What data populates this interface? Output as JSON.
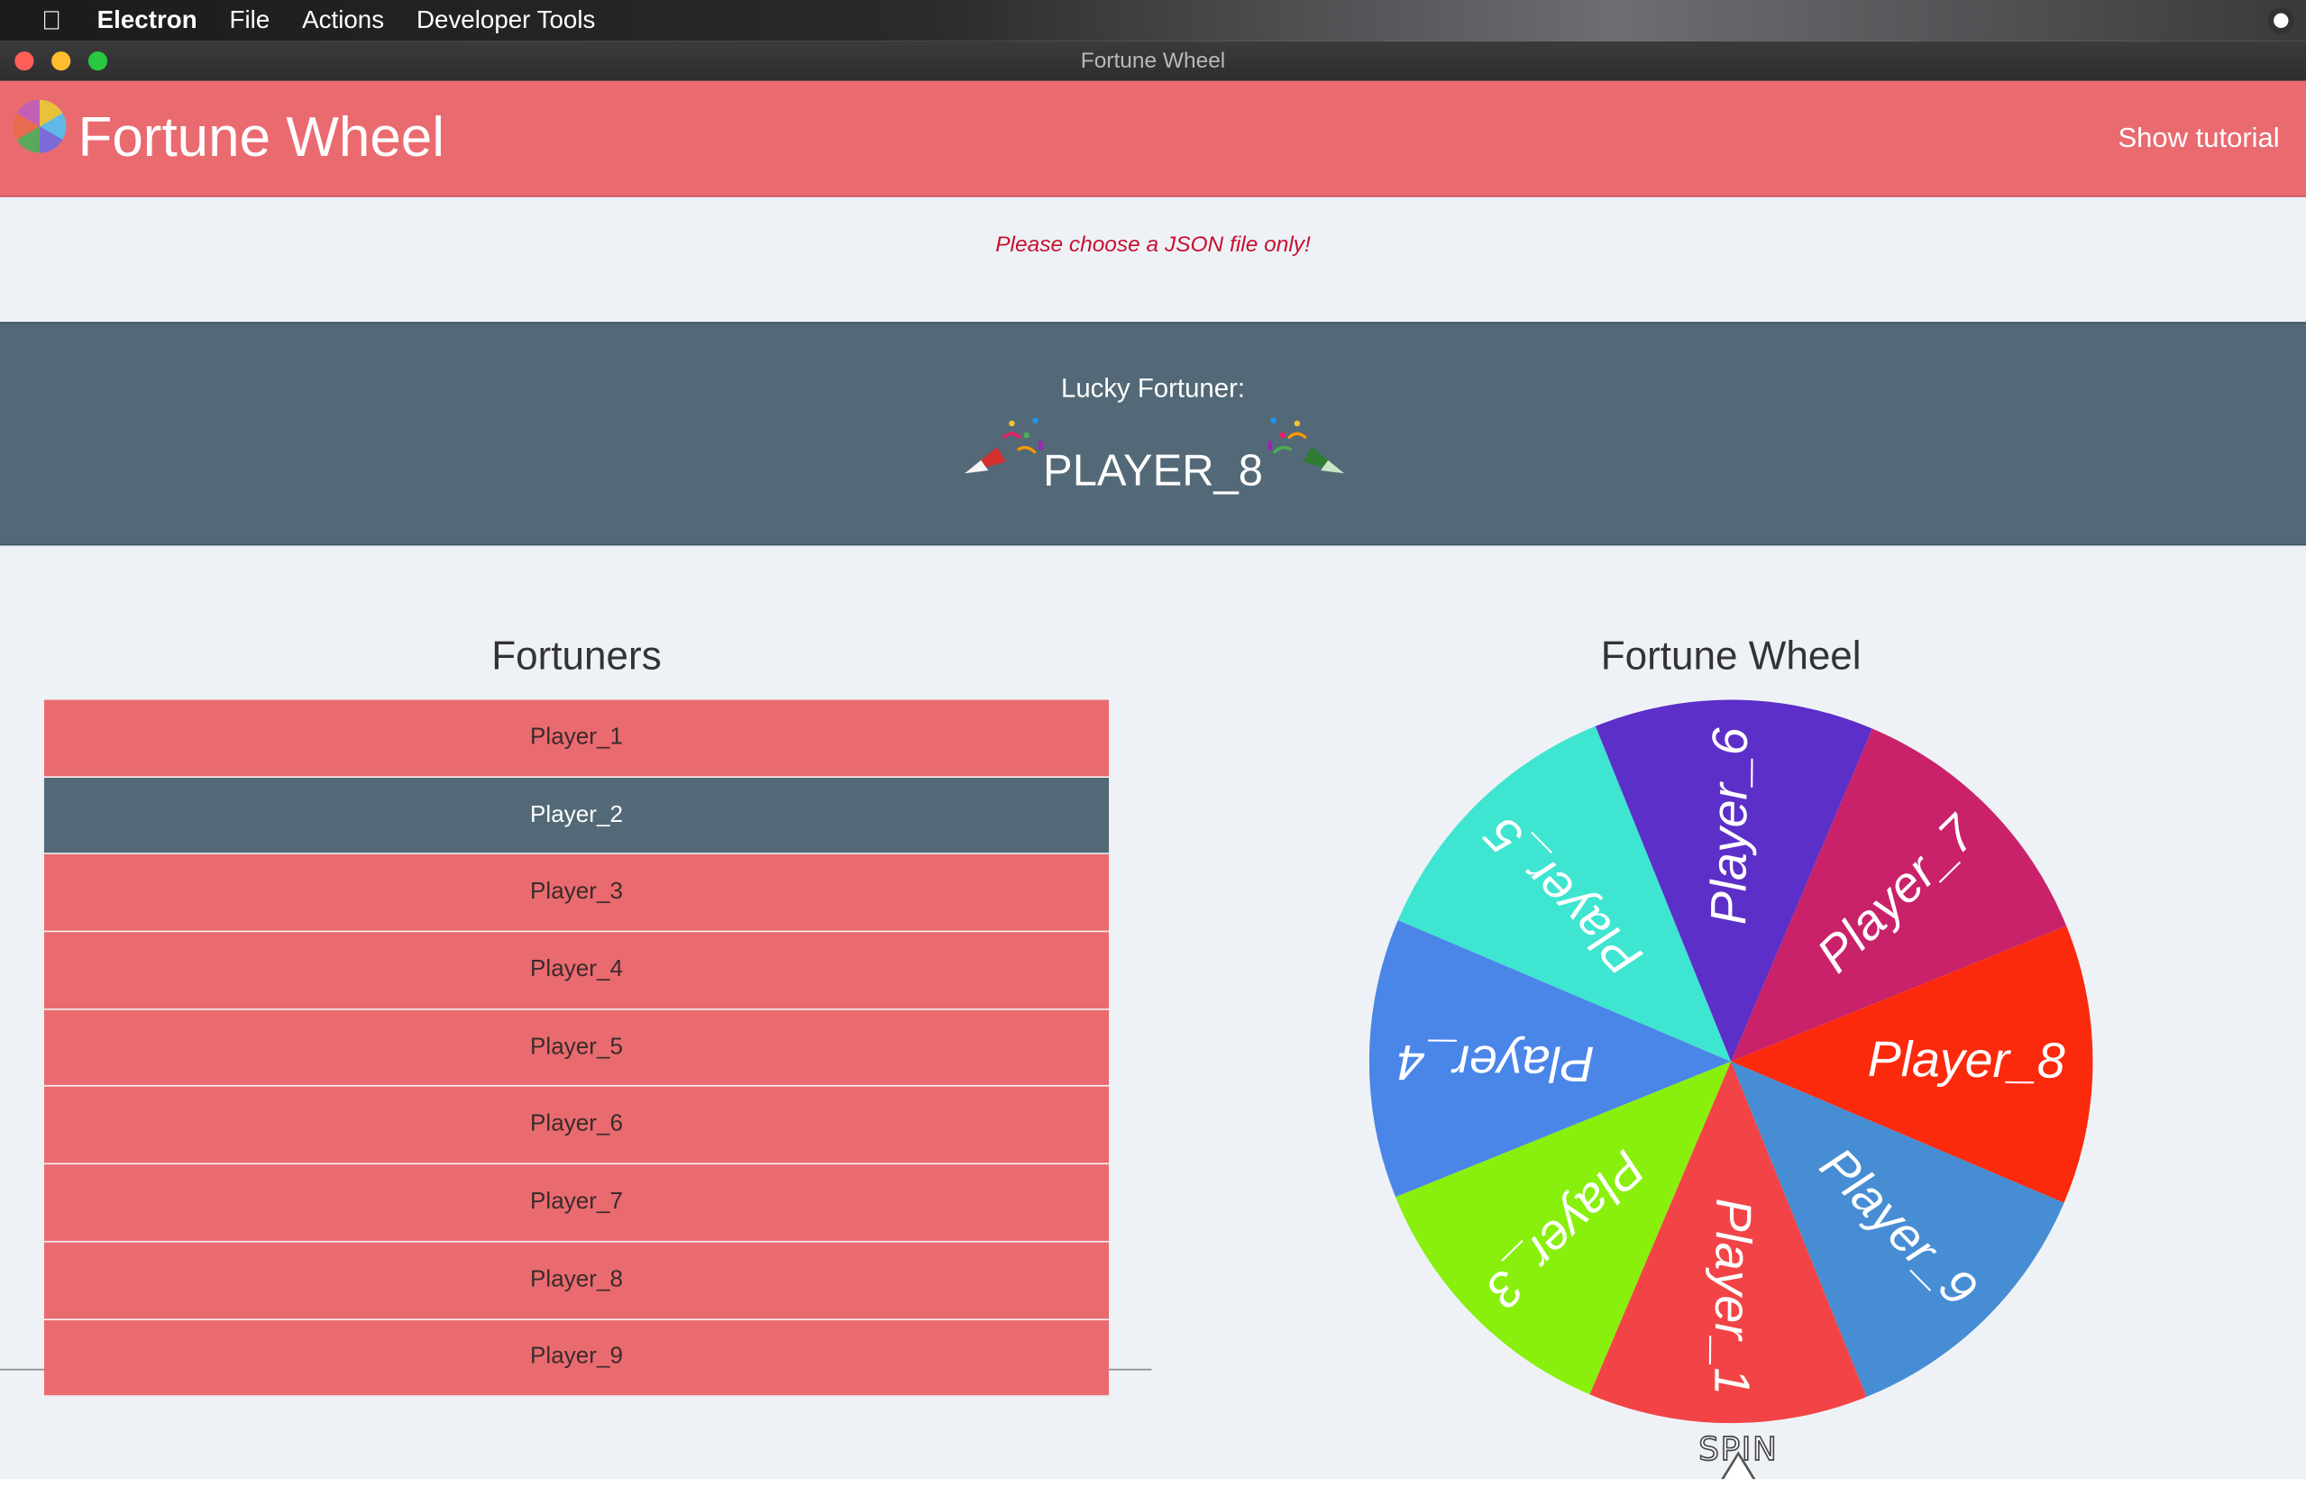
{
  "menubar": {
    "app_name": "Electron",
    "items": [
      "File",
      "Actions",
      "Developer Tools"
    ]
  },
  "window": {
    "title": "Fortune Wheel"
  },
  "header": {
    "title": "Fortune Wheel",
    "tutorial_label": "Show tutorial"
  },
  "error_message": "Please choose a JSON file only!",
  "lucky": {
    "label": "Lucky Fortuner:",
    "winner": "PLAYER_8"
  },
  "fortuners": {
    "title": "Fortuners",
    "players": [
      "Player_1",
      "Player_2",
      "Player_3",
      "Player_4",
      "Player_5",
      "Player_6",
      "Player_7",
      "Player_8",
      "Player_9"
    ],
    "active": "Player_2"
  },
  "wheel": {
    "title": "Fortune Wheel",
    "spin_label": "SPIN",
    "segments": [
      {
        "label": "Player_4",
        "color": "#4a86e8"
      },
      {
        "label": "Player_5",
        "color": "#3ee5d0"
      },
      {
        "label": "Player_6",
        "color": "#5c2fc8"
      },
      {
        "label": "Player_7",
        "color": "#c9226a"
      },
      {
        "label": "Player_8",
        "color": "#fb2a0c"
      },
      {
        "label": "Player_9",
        "color": "#478dd4"
      },
      {
        "label": "Player_1",
        "color": "#f24446"
      },
      {
        "label": "Player_3",
        "color": "#88f00c"
      }
    ]
  },
  "colors": {
    "accent": "#e96b70",
    "slate": "#536977",
    "error": "#c8102e"
  }
}
